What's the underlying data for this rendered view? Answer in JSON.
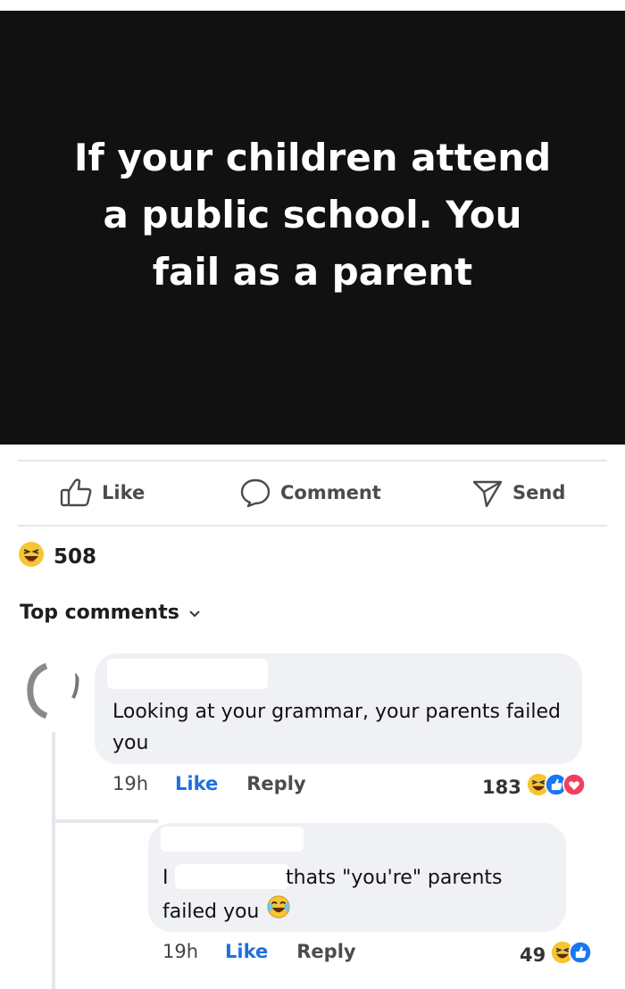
{
  "post": {
    "text": "If your children attend a public school. You fail as a parent"
  },
  "actions": {
    "like_label": "Like",
    "comment_label": "Comment",
    "send_label": "Send"
  },
  "reactions": {
    "count": "508",
    "icon": "laugh-emoji-icon"
  },
  "comments_header": {
    "label": "Top comments",
    "icon": "chevron-down-icon"
  },
  "comments": [
    {
      "text": "Looking at your grammar, your parents failed you",
      "time": "19h",
      "like_label": "Like",
      "reply_label": "Reply",
      "reaction_count": "183",
      "reaction_icons": [
        "laugh-emoji-icon",
        "like-icon",
        "love-icon"
      ]
    },
    {
      "text_prefix": "I",
      "text_line1": "thats \"you're\" parents",
      "text_line2": "failed you",
      "time": "19h",
      "like_label": "Like",
      "reply_label": "Reply",
      "reaction_count": "49",
      "reaction_icons": [
        "laugh-emoji-icon",
        "like-icon"
      ]
    }
  ],
  "colors": {
    "like_link": "#1f6fe0",
    "bubble": "#eff1f4",
    "post_background": "#111111"
  }
}
